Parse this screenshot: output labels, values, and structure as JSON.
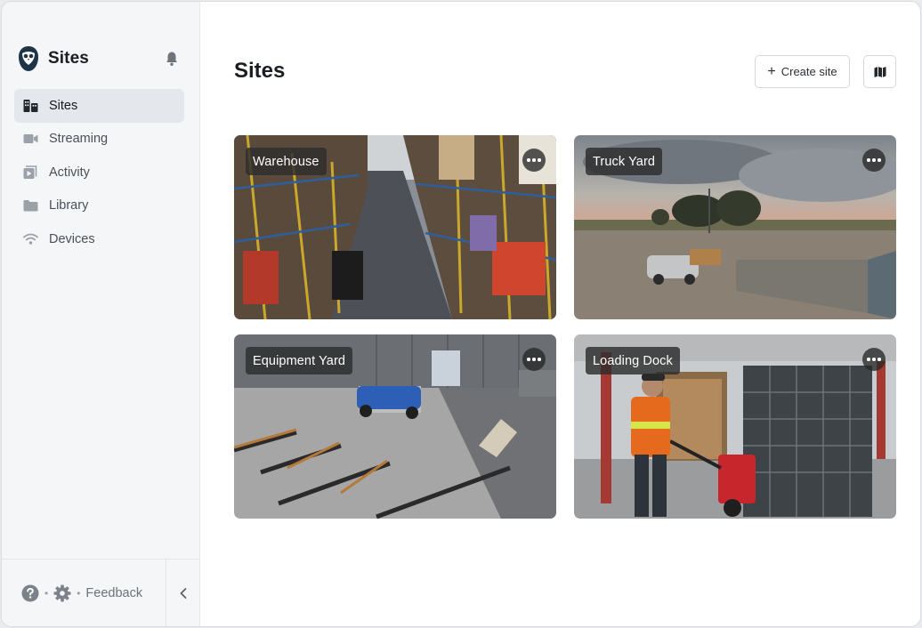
{
  "app": {
    "name": "Sites"
  },
  "sidebar": {
    "items": [
      {
        "label": "Sites",
        "icon": "sites-icon",
        "active": true
      },
      {
        "label": "Streaming",
        "icon": "video-camera-icon",
        "active": false
      },
      {
        "label": "Activity",
        "icon": "activity-icon",
        "active": false
      },
      {
        "label": "Library",
        "icon": "folder-icon",
        "active": false
      },
      {
        "label": "Devices",
        "icon": "wifi-icon",
        "active": false
      }
    ],
    "footer": {
      "feedback_label": "Feedback"
    }
  },
  "main": {
    "title": "Sites",
    "create_label": "Create site"
  },
  "sites": [
    {
      "name": "Warehouse"
    },
    {
      "name": "Truck Yard"
    },
    {
      "name": "Equipment Yard"
    },
    {
      "name": "Loading Dock"
    }
  ],
  "colors": {
    "sidebar_bg": "#f4f6f8",
    "active_item_bg": "#e4e8ec",
    "label_bg": "#2d2d2d"
  }
}
